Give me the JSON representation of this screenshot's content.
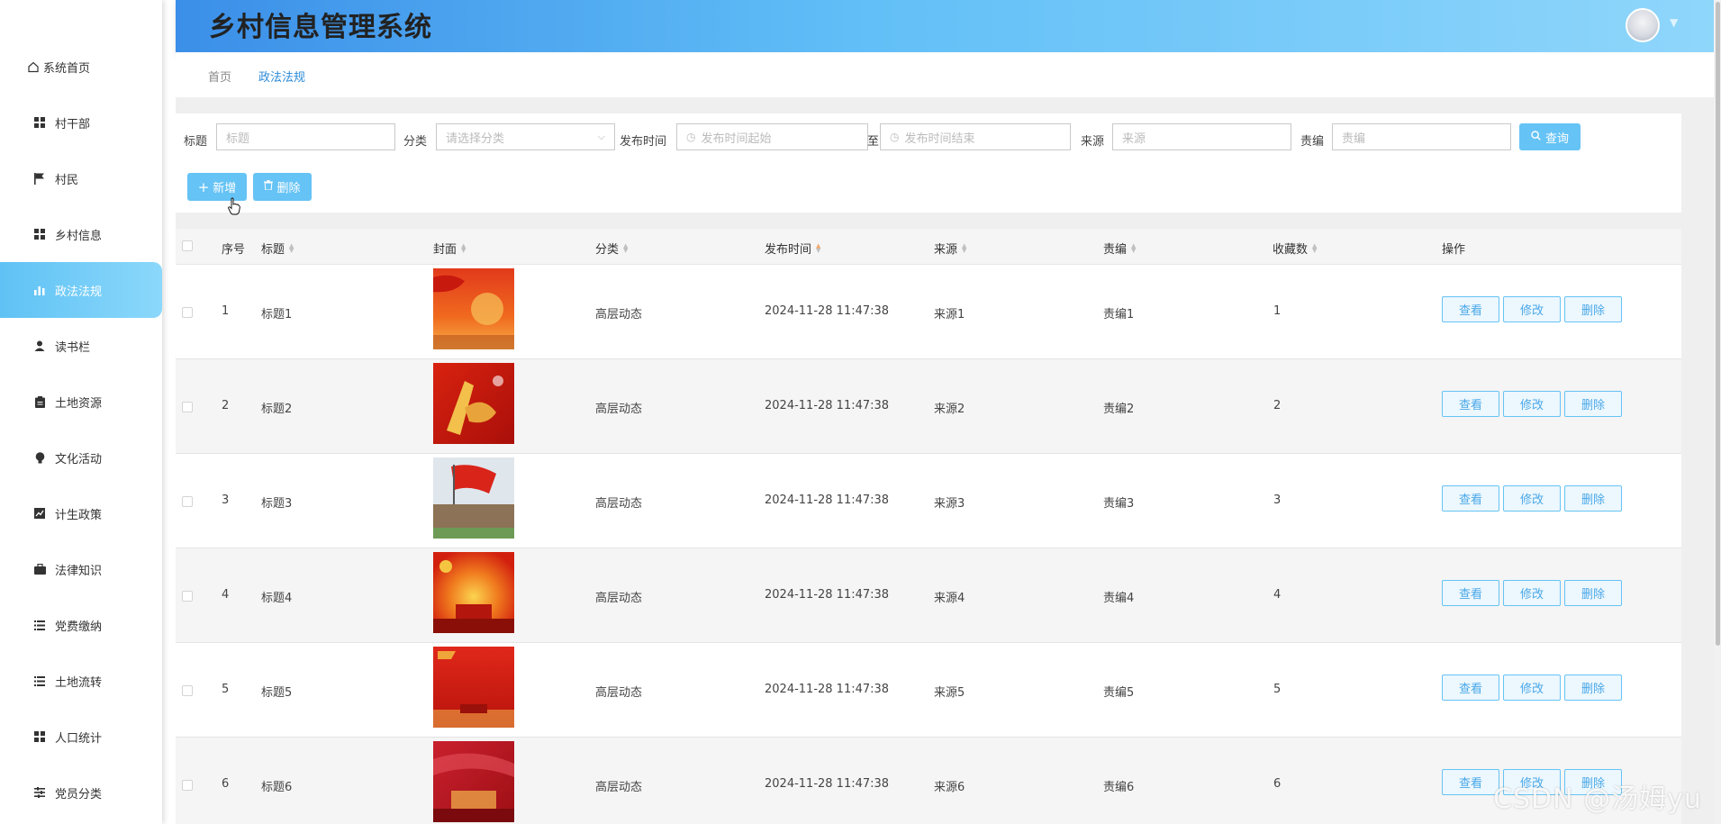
{
  "app": {
    "title": "乡村信息管理系统"
  },
  "sidebar": {
    "items": [
      {
        "label": "系统首页",
        "icon": "home-icon"
      },
      {
        "label": "村干部",
        "icon": "grid-icon"
      },
      {
        "label": "村民",
        "icon": "flag-icon"
      },
      {
        "label": "乡村信息",
        "icon": "grid-icon"
      },
      {
        "label": "政法法规",
        "icon": "bar-chart-icon",
        "active": true
      },
      {
        "label": "读书栏",
        "icon": "user-icon"
      },
      {
        "label": "土地资源",
        "icon": "clipboard-icon"
      },
      {
        "label": "文化活动",
        "icon": "bulb-icon"
      },
      {
        "label": "计生政策",
        "icon": "line-chart-icon"
      },
      {
        "label": "法律知识",
        "icon": "briefcase-icon"
      },
      {
        "label": "党费缴纳",
        "icon": "list-icon"
      },
      {
        "label": "土地流转",
        "icon": "list-icon"
      },
      {
        "label": "人口统计",
        "icon": "grid-icon"
      },
      {
        "label": "党员分类",
        "icon": "sliders-icon"
      }
    ]
  },
  "breadcrumb": {
    "home": "首页",
    "current": "政法法规"
  },
  "filter": {
    "title_label": "标题",
    "title_placeholder": "标题",
    "category_label": "分类",
    "category_placeholder": "请选择分类",
    "time_label": "发布时间",
    "time_start_placeholder": "发布时间起始",
    "time_sep": "至",
    "time_end_placeholder": "发布时间结束",
    "source_label": "来源",
    "source_placeholder": "来源",
    "editor_label": "责编",
    "editor_placeholder": "责编",
    "search_button": "查询"
  },
  "actions": {
    "add_button": "新增",
    "delete_button": "删除"
  },
  "table": {
    "headers": {
      "index": "序号",
      "title": "标题",
      "cover": "封面",
      "category": "分类",
      "publish_time": "发布时间",
      "source": "来源",
      "editor": "责编",
      "favorites": "收藏数",
      "ops": "操作"
    },
    "row_actions": {
      "view": "查看",
      "edit": "修改",
      "delete": "删除"
    },
    "rows": [
      {
        "index": "1",
        "title": "标题1",
        "category": "高层动态",
        "publish_time": "2024-11-28 11:47:38",
        "source": "来源1",
        "editor": "责编1",
        "favorites": "1"
      },
      {
        "index": "2",
        "title": "标题2",
        "category": "高层动态",
        "publish_time": "2024-11-28 11:47:38",
        "source": "来源2",
        "editor": "责编2",
        "favorites": "2"
      },
      {
        "index": "3",
        "title": "标题3",
        "category": "高层动态",
        "publish_time": "2024-11-28 11:47:38",
        "source": "来源3",
        "editor": "责编3",
        "favorites": "3"
      },
      {
        "index": "4",
        "title": "标题4",
        "category": "高层动态",
        "publish_time": "2024-11-28 11:47:38",
        "source": "来源4",
        "editor": "责编4",
        "favorites": "4"
      },
      {
        "index": "5",
        "title": "标题5",
        "category": "高层动态",
        "publish_time": "2024-11-28 11:47:38",
        "source": "来源5",
        "editor": "责编5",
        "favorites": "5"
      },
      {
        "index": "6",
        "title": "标题6",
        "category": "高层动态",
        "publish_time": "2024-11-28 11:47:38",
        "source": "来源6",
        "editor": "责编6",
        "favorites": "6"
      }
    ]
  },
  "watermark": "CSDN @汤姆yu",
  "colors": {
    "accent": "#66c3f5",
    "header_start": "#3b8fe8",
    "header_end": "#8fd6fb",
    "link": "#2a8ad8"
  }
}
